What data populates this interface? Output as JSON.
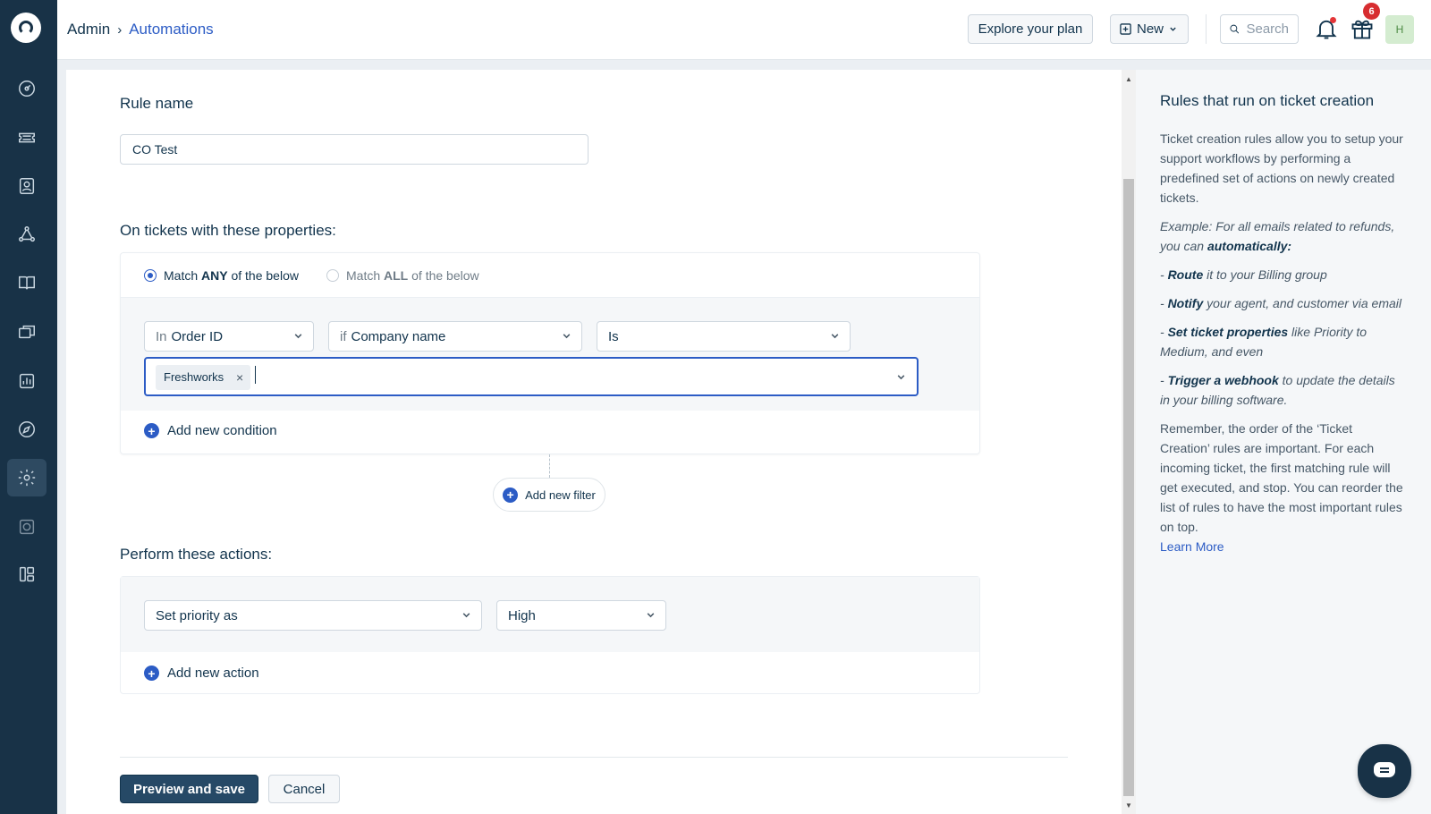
{
  "breadcrumb": {
    "root": "Admin",
    "current": "Automations"
  },
  "header": {
    "explore_label": "Explore your plan",
    "new_label": "New",
    "search_placeholder": "Search",
    "gift_badge": "6",
    "avatar_initial": "H"
  },
  "form": {
    "rule_name_label": "Rule name",
    "rule_name_value": "CO Test",
    "conditions_heading": "On tickets with these properties:",
    "match_any": {
      "prefix": "Match ",
      "bold": "ANY",
      "suffix": " of the below",
      "selected": true
    },
    "match_all": {
      "prefix": "Match ",
      "bold": "ALL",
      "suffix": " of the below",
      "selected": false
    },
    "condition": {
      "field_prefix": "In",
      "field": "Order ID",
      "sub_prefix": "if",
      "sub_field": "Company name",
      "operator": "Is",
      "values": [
        "Freshworks"
      ]
    },
    "add_condition_label": "Add new condition",
    "add_filter_label": "Add new filter",
    "actions_heading": "Perform these actions:",
    "action": {
      "type": "Set priority as",
      "value": "High"
    },
    "add_action_label": "Add new action",
    "preview_save_label": "Preview and save",
    "cancel_label": "Cancel"
  },
  "help": {
    "title": "Rules that run on ticket creation",
    "intro": "Ticket creation rules allow you to setup your support workflows by performing a predefined set of actions on newly created tickets.",
    "example_prefix": "Example: For all emails related to refunds, you can ",
    "example_bold": "automatically:",
    "bullets": [
      {
        "bold": "Route",
        "text": " it to your Billing group"
      },
      {
        "bold": "Notify",
        "text": " your agent, and customer via email"
      },
      {
        "bold": "Set ticket properties",
        "text": " like Priority to Medium, and even"
      },
      {
        "bold": "Trigger a webhook",
        "text": " to update the details in your billing software."
      }
    ],
    "remember": "Remember, the order of the ‘Ticket Creation’ rules are important. For each incoming ticket, the first matching rule will get executed, and stop. You can reorder the list of rules to have the most important rules on top.",
    "learn_more": "Learn More"
  },
  "colors": {
    "nav_bg": "#183247",
    "accent": "#2c5cc5",
    "primary_button": "#264966",
    "badge": "#d72d30"
  },
  "icons": [
    "logo-icon",
    "dashboard-icon",
    "tickets-icon",
    "contacts-icon",
    "groups-icon",
    "solutions-icon",
    "forums-icon",
    "reports-icon",
    "explore-icon",
    "admin-gear-icon",
    "marketplace-icon",
    "apps-icon",
    "bell-icon",
    "gift-icon",
    "search-icon",
    "chat-icon"
  ]
}
